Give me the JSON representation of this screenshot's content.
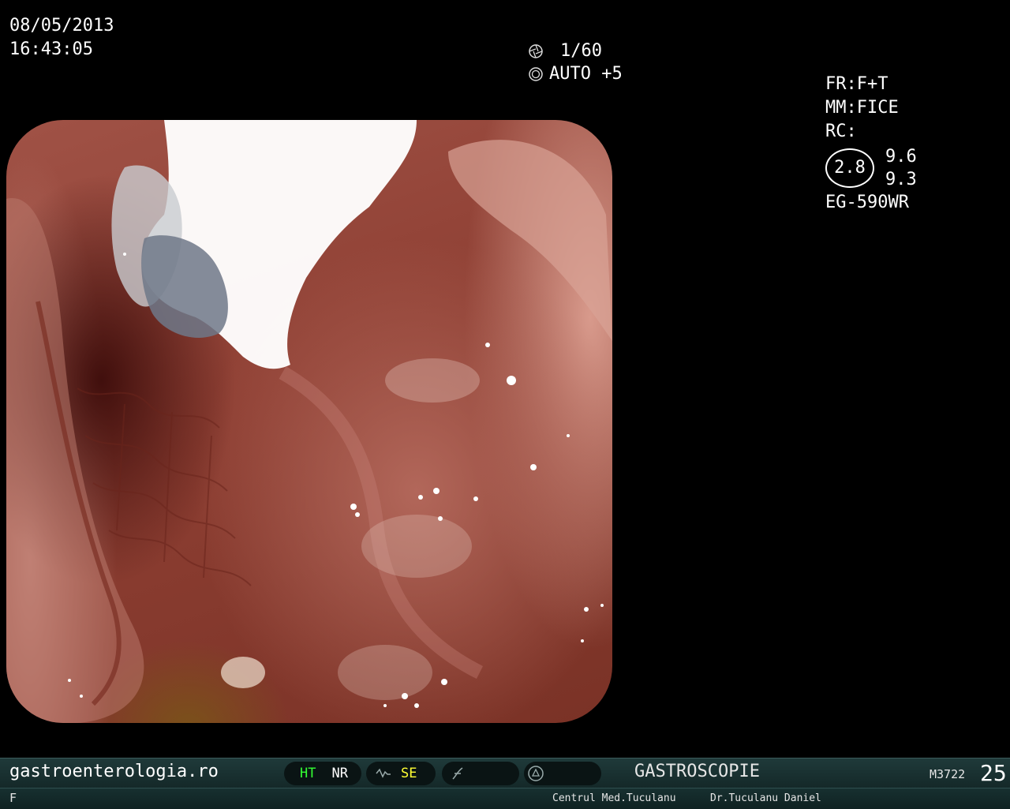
{
  "osd": {
    "date": "08/05/2013",
    "time": "16:43:05",
    "shutter": "1/60",
    "exposure": "AUTO +5",
    "fr": "FR:F+T",
    "mm": "MM:FICE",
    "rc": "RC:",
    "rc_value": "2.8",
    "val_top": "9.6",
    "val_bottom": "9.3",
    "scope_model": "EG-590WR",
    "icons": [
      "shutter-icon",
      "iris-icon"
    ]
  },
  "image": {
    "description_icon": "endoscopic-view"
  },
  "status_bar": {
    "website": "gastroenterologia.ro",
    "ht": "HT",
    "nr": "NR",
    "se": "SE",
    "procedure": "GASTROSCOPIE",
    "code": "M3722",
    "number": "25",
    "icons": [
      "wave-icon",
      "freeze-icon",
      "capture-icon"
    ]
  },
  "info_bar": {
    "label": "F",
    "center": "Centrul Med.Tuculanu",
    "doctor": "Dr.Tuculanu Daniel"
  },
  "colors": {
    "ht": "#33ff33",
    "se": "#ffff33",
    "bar": "#1f3a3a"
  }
}
